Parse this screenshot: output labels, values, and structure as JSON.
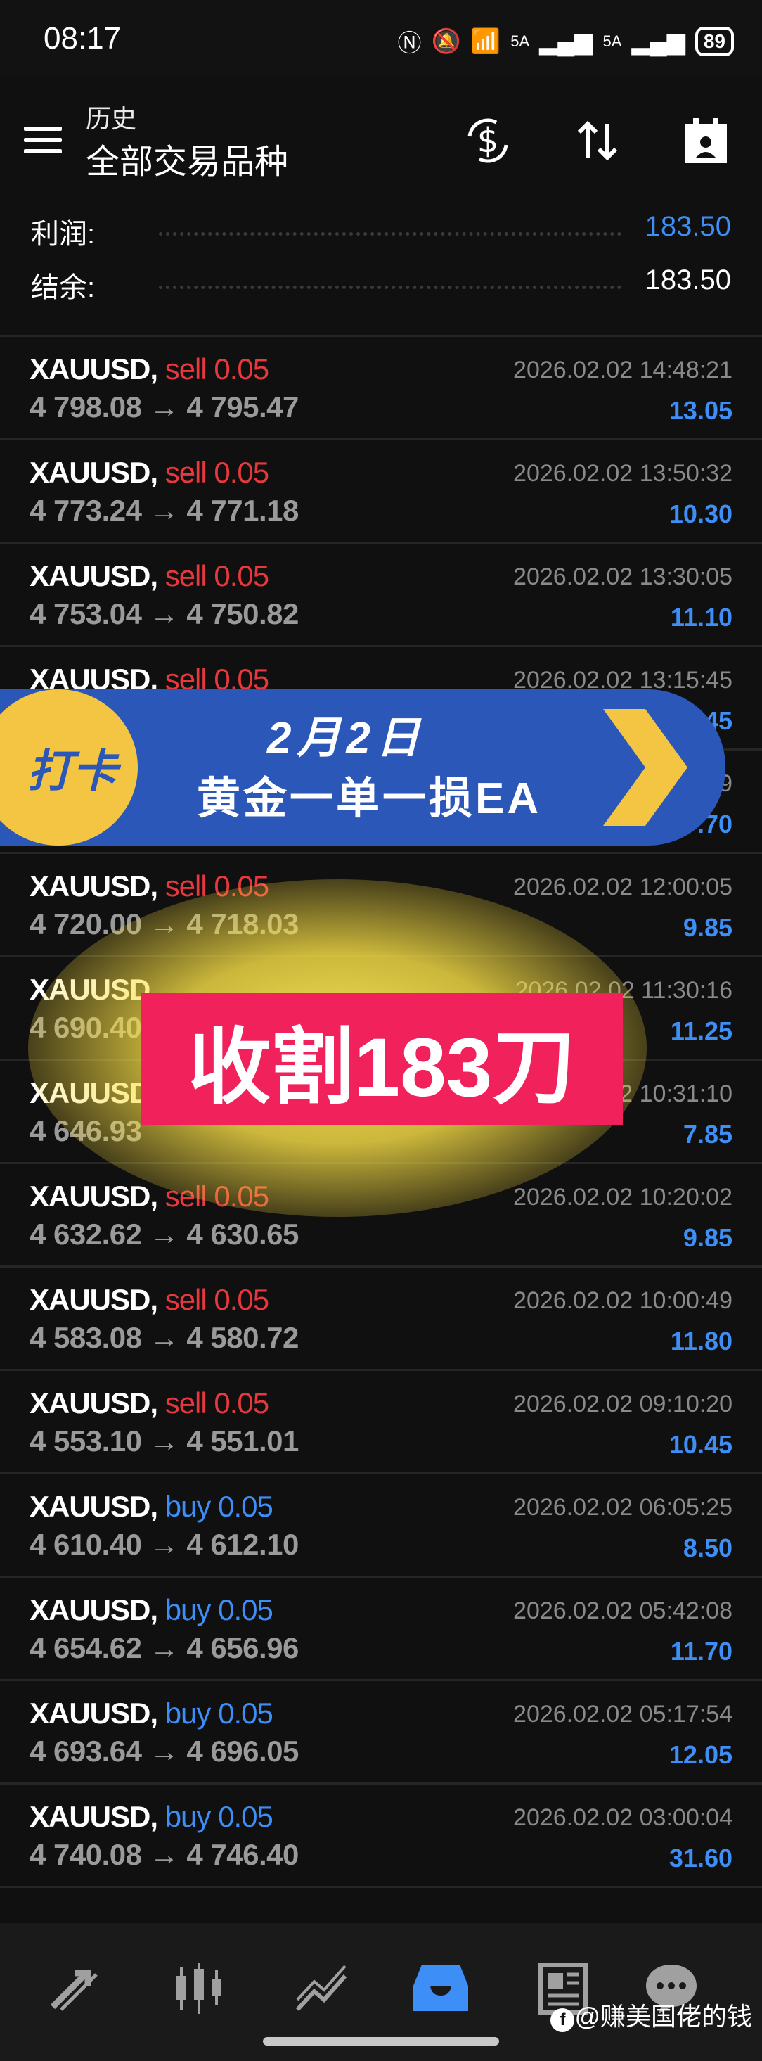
{
  "status": {
    "time": "08:17",
    "network1": "5A",
    "network2": "5A",
    "battery": "89"
  },
  "header": {
    "subtitle": "历史",
    "title": "全部交易品种"
  },
  "summary": {
    "profit_label": "利润:",
    "profit_value": "183.50",
    "balance_label": "结余:",
    "balance_value": "183.50"
  },
  "colors": {
    "profit_blue": "#3d8ef6",
    "sell_red": "#e8383d",
    "buy_blue": "#3d8ef6",
    "banner_blue": "#2a57b8",
    "banner_yellow": "#f4c542",
    "harvest_pink": "#f0215b"
  },
  "trades": [
    {
      "symbol": "XAUUSD,",
      "side": "sell",
      "volume": "0.05",
      "open": "4 798.08",
      "close": "4 795.47",
      "time": "2026.02.02 14:48:21",
      "profit": "13.05"
    },
    {
      "symbol": "XAUUSD,",
      "side": "sell",
      "volume": "0.05",
      "open": "4 773.24",
      "close": "4 771.18",
      "time": "2026.02.02 13:50:32",
      "profit": "10.30"
    },
    {
      "symbol": "XAUUSD,",
      "side": "sell",
      "volume": "0.05",
      "open": "4 753.04",
      "close": "4 750.82",
      "time": "2026.02.02 13:30:05",
      "profit": "11.10"
    },
    {
      "symbol": "XAUUSD,",
      "side": "sell",
      "volume": "0.05",
      "open": "",
      "close": "",
      "time": "2026.02.02 13:15:45",
      "profit": "45"
    },
    {
      "symbol": "",
      "side": "",
      "volume": "",
      "open": "",
      "close": "",
      "time": "9",
      "profit": ".70"
    },
    {
      "symbol": "XAUUSD,",
      "side": "sell",
      "volume": "0.05",
      "open": "4 720.00",
      "close": "4 718.03",
      "time": "2026.02.02 12:00:05",
      "profit": "9.85"
    },
    {
      "symbol": "XAUUSD,",
      "side": "",
      "volume": "",
      "open": "4 690.40",
      "close": "",
      "time": "2026.02.02 11:30:16",
      "profit": "11.25"
    },
    {
      "symbol": "XAUUSD,",
      "side": "",
      "volume": "",
      "open": "4 646.93",
      "close": "",
      "time": "2 10:31:10",
      "profit": "7.85"
    },
    {
      "symbol": "XAUUSD,",
      "side": "sell",
      "volume": "0.05",
      "open": "4 632.62",
      "close": "4 630.65",
      "time": "2026.02.02 10:20:02",
      "profit": "9.85"
    },
    {
      "symbol": "XAUUSD,",
      "side": "sell",
      "volume": "0.05",
      "open": "4 583.08",
      "close": "4 580.72",
      "time": "2026.02.02 10:00:49",
      "profit": "11.80"
    },
    {
      "symbol": "XAUUSD,",
      "side": "sell",
      "volume": "0.05",
      "open": "4 553.10",
      "close": "4 551.01",
      "time": "2026.02.02 09:10:20",
      "profit": "10.45"
    },
    {
      "symbol": "XAUUSD,",
      "side": "buy",
      "volume": "0.05",
      "open": "4 610.40",
      "close": "4 612.10",
      "time": "2026.02.02 06:05:25",
      "profit": "8.50"
    },
    {
      "symbol": "XAUUSD,",
      "side": "buy",
      "volume": "0.05",
      "open": "4 654.62",
      "close": "4 656.96",
      "time": "2026.02.02 05:42:08",
      "profit": "11.70"
    },
    {
      "symbol": "XAUUSD,",
      "side": "buy",
      "volume": "0.05",
      "open": "4 693.64",
      "close": "4 696.05",
      "time": "2026.02.02 05:17:54",
      "profit": "12.05"
    },
    {
      "symbol": "XAUUSD,",
      "side": "buy",
      "volume": "0.05",
      "open": "4 740.08",
      "close": "4 746.40",
      "time": "2026.02.02 03:00:04",
      "profit": "31.60"
    }
  ],
  "overlay": {
    "badge": "打卡",
    "line1": "2月2日",
    "line2": "黄金一单一损EA",
    "harvest": "收割183刀"
  },
  "nav": {
    "items": [
      "trade-icon",
      "chart-candles-icon",
      "trend-icon",
      "history-icon",
      "news-icon",
      "chat-icon"
    ],
    "active": "history-icon"
  },
  "watermark": "@赚美国佬的钱"
}
